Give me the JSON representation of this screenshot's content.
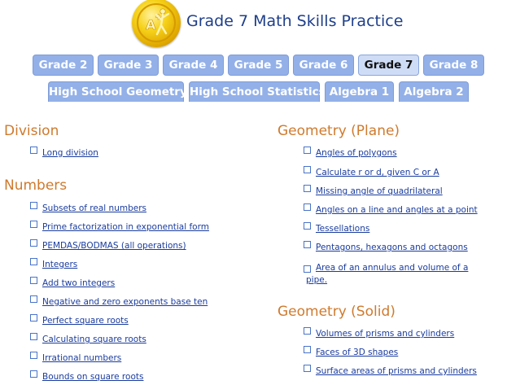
{
  "site": {
    "title": "Grade 7 Math Skills Practice"
  },
  "grade_tabs": [
    {
      "label": "Grade 2",
      "active": false
    },
    {
      "label": "Grade 3",
      "active": false
    },
    {
      "label": "Grade 4",
      "active": false
    },
    {
      "label": "Grade 5",
      "active": false
    },
    {
      "label": "Grade 6",
      "active": false
    },
    {
      "label": "Grade 7",
      "active": true
    },
    {
      "label": "Grade 8",
      "active": false
    }
  ],
  "hs_tabs": [
    {
      "label": "High School Geometry"
    },
    {
      "label": "High School Statistics"
    },
    {
      "label": "Algebra 1"
    },
    {
      "label": "Algebra 2"
    }
  ],
  "sections": {
    "division": {
      "title": "Division",
      "items": [
        "Long division"
      ]
    },
    "numbers": {
      "title": "Numbers",
      "items": [
        "Subsets of real numbers",
        "Prime factorization in exponential form",
        "PEMDAS/BODMAS (all operations)",
        "Integers",
        "Add two integers",
        "Negative and zero exponents base ten",
        "Perfect square roots",
        "Calculating square roots",
        "Irrational numbers",
        "Bounds on square roots"
      ]
    },
    "geometry_plane": {
      "title": "Geometry (Plane)",
      "items": [
        "Angles of polygons",
        "Calculate r or d, given C or A",
        "Missing angle of quadrilateral",
        "Angles on a line and angles at a point",
        "Tessellations",
        "Pentagons, hexagons and octagons",
        "Area of an annulus and volume of a pipe."
      ]
    },
    "geometry_solid": {
      "title": "Geometry (Solid)",
      "items": [
        "Volumes of prisms and cylinders",
        "Faces of 3D shapes",
        "Surface areas of prisms and cylinders"
      ]
    }
  }
}
